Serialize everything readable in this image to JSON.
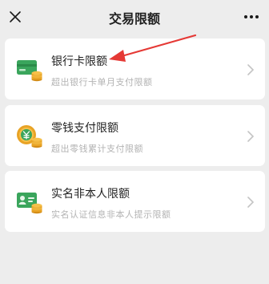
{
  "header": {
    "title": "交易限额",
    "close_icon": "close-icon",
    "more_icon": "more-icon"
  },
  "items": [
    {
      "label": "银行卡限额",
      "subtitle": "超出银行卡单月支付限额",
      "icon": "bank-card-icon"
    },
    {
      "label": "零钱支付限额",
      "subtitle": "超出零钱累计支付限额",
      "icon": "change-wallet-icon"
    },
    {
      "label": "实名非本人限额",
      "subtitle": "实名认证信息非本人提示限额",
      "icon": "id-card-icon"
    }
  ],
  "colors": {
    "accent_green": "#3aa55c",
    "coin_orange": "#e8a325",
    "annotation_red": "#e53935"
  }
}
